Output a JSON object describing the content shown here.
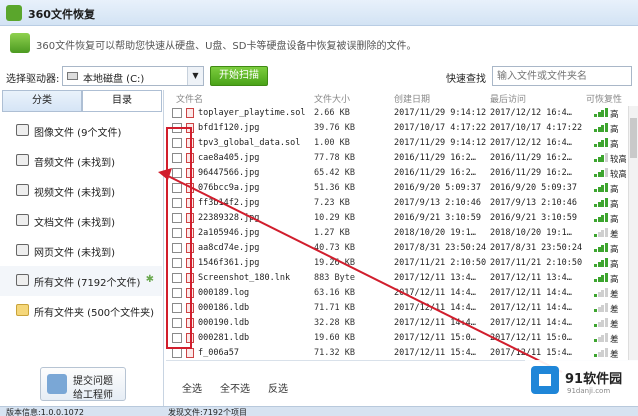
{
  "window": {
    "title": "360文件恢复"
  },
  "info": {
    "text": "360文件恢复可以帮助您快速从硬盘、U盘、SD卡等硬盘设备中恢复被误删除的文件。"
  },
  "toolbar": {
    "drive_label": "选择驱动器:",
    "drive_value": "本地磁盘 (C:)",
    "scan_label": "开始扫描",
    "quick_search_label": "快速查找",
    "search_placeholder": "输入文件或文件夹名"
  },
  "sidebar": {
    "tabs": [
      {
        "label": "分类"
      },
      {
        "label": "目录"
      }
    ],
    "items": [
      {
        "label": "图像文件 (9个文件)"
      },
      {
        "label": "音频文件 (未找到)"
      },
      {
        "label": "视频文件 (未找到)"
      },
      {
        "label": "文档文件 (未找到)"
      },
      {
        "label": "网页文件 (未找到)"
      },
      {
        "label": "所有文件 (7192个文件)"
      },
      {
        "label": "所有文件夹 (500个文件夹)"
      }
    ],
    "feedback_line1": "提交问题",
    "feedback_line2": "给工程师"
  },
  "filelist": {
    "columns": {
      "name": "文件名",
      "size": "文件大小",
      "created": "创建日期",
      "accessed": "最后访问",
      "recoverable": "可恢复性"
    },
    "rows": [
      {
        "name": "toplayer_playtime.sol",
        "size": "2.66 KB",
        "created": "2017/11/29 9:14:12",
        "accessed": "2017/12/12 16:4…",
        "recoverable": "高"
      },
      {
        "name": "bfd1f120.jpg",
        "size": "39.76 KB",
        "created": "2017/10/17 4:17:22",
        "accessed": "2017/10/17 4:17:22",
        "recoverable": "高"
      },
      {
        "name": "tpv3_global_data.sol",
        "size": "1.00 KB",
        "created": "2017/11/29 9:14:12",
        "accessed": "2017/12/12 16:4…",
        "recoverable": "高"
      },
      {
        "name": "cae8a405.jpg",
        "size": "77.78 KB",
        "created": "2016/11/29 16:2…",
        "accessed": "2016/11/29 16:2…",
        "recoverable": "较高"
      },
      {
        "name": "96447566.jpg",
        "size": "65.42 KB",
        "created": "2016/11/29 16:2…",
        "accessed": "2016/11/29 16:2…",
        "recoverable": "较高"
      },
      {
        "name": "076bcc9a.jpg",
        "size": "51.36 KB",
        "created": "2016/9/20 5:09:37",
        "accessed": "2016/9/20 5:09:37",
        "recoverable": "高"
      },
      {
        "name": "ff3b14f2.jpg",
        "size": "7.23 KB",
        "created": "2017/9/13 2:10:46",
        "accessed": "2017/9/13 2:10:46",
        "recoverable": "高"
      },
      {
        "name": "22389328.jpg",
        "size": "10.29 KB",
        "created": "2016/9/21 3:10:59",
        "accessed": "2016/9/21 3:10:59",
        "recoverable": "高"
      },
      {
        "name": "2a105946.jpg",
        "size": "1.27 KB",
        "created": "2018/10/20 19:1…",
        "accessed": "2018/10/20 19:1…",
        "recoverable": "差"
      },
      {
        "name": "aa8cd74e.jpg",
        "size": "40.73 KB",
        "created": "2017/8/31 23:50:24",
        "accessed": "2017/8/31 23:50:24",
        "recoverable": "高"
      },
      {
        "name": "1546f361.jpg",
        "size": "19.26 KB",
        "created": "2017/11/21 2:10:50",
        "accessed": "2017/11/21 2:10:50",
        "recoverable": "高"
      },
      {
        "name": "Screenshot_180.lnk",
        "size": "883 Byte",
        "created": "2017/12/11 13:4…",
        "accessed": "2017/12/11 13:4…",
        "recoverable": "高"
      },
      {
        "name": "000189.log",
        "size": "63.16 KB",
        "created": "2017/12/11 14:4…",
        "accessed": "2017/12/11 14:4…",
        "recoverable": "差"
      },
      {
        "name": "000186.ldb",
        "size": "71.71 KB",
        "created": "2017/12/11 14:4…",
        "accessed": "2017/12/11 14:4…",
        "recoverable": "差"
      },
      {
        "name": "000190.ldb",
        "size": "32.28 KB",
        "created": "2017/12/11 14:4…",
        "accessed": "2017/12/11 14:4…",
        "recoverable": "差"
      },
      {
        "name": "000281.ldb",
        "size": "19.60 KB",
        "created": "2017/12/11 15:0…",
        "accessed": "2017/12/11 15:0…",
        "recoverable": "差"
      },
      {
        "name": "f_006a57",
        "size": "71.32 KB",
        "created": "2017/12/11 15:4…",
        "accessed": "2017/12/11 15:4…",
        "recoverable": "差"
      }
    ]
  },
  "actions": {
    "select_all": "全选",
    "select_none": "全不选",
    "invert": "反选"
  },
  "status": {
    "left": "版本信息:1.0.0.1072",
    "right": "发现文件:7192个项目"
  },
  "watermark": {
    "text": "91软件园",
    "sub": "91danji.com"
  },
  "colors": {
    "accent_green": "#4aa318",
    "highlight_red": "#d11e2d"
  }
}
